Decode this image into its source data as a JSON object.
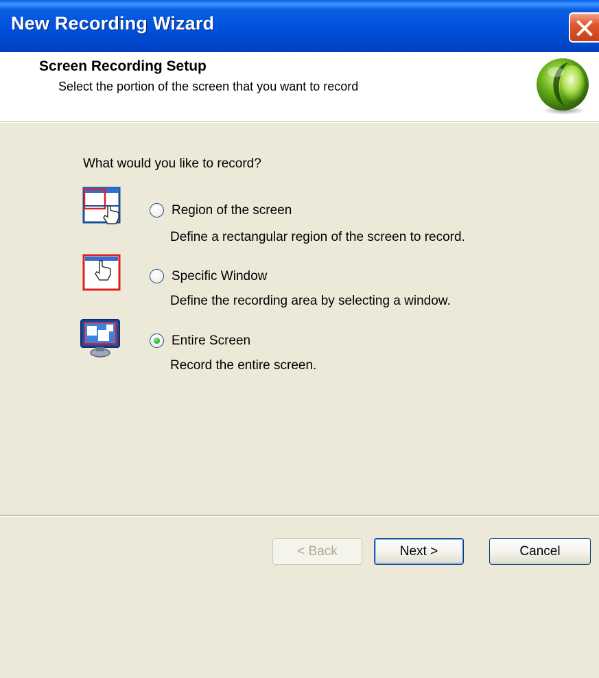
{
  "window": {
    "title": "New Recording Wizard"
  },
  "header": {
    "title": "Screen Recording Setup",
    "subtitle": "Select the portion of the screen that you want to record"
  },
  "body": {
    "question": "What would you like to record?",
    "options": [
      {
        "label": "Region of the screen",
        "description": "Define a rectangular region of the screen to record.",
        "selected": false,
        "icon": "region-select-icon"
      },
      {
        "label": "Specific Window",
        "description": "Define the recording area by selecting a window.",
        "selected": false,
        "icon": "window-select-icon"
      },
      {
        "label": "Entire Screen",
        "description": "Record the entire screen.",
        "selected": true,
        "icon": "monitor-icon"
      }
    ]
  },
  "buttons": {
    "back": "< Back",
    "next": "Next >",
    "cancel": "Cancel"
  },
  "colors": {
    "titlebar": "#0052DD",
    "dialog_bg": "#ECE9D8",
    "header_bg": "#FFFFFF",
    "close_button": "#E2562B",
    "radio_dot": "#29B43E"
  }
}
